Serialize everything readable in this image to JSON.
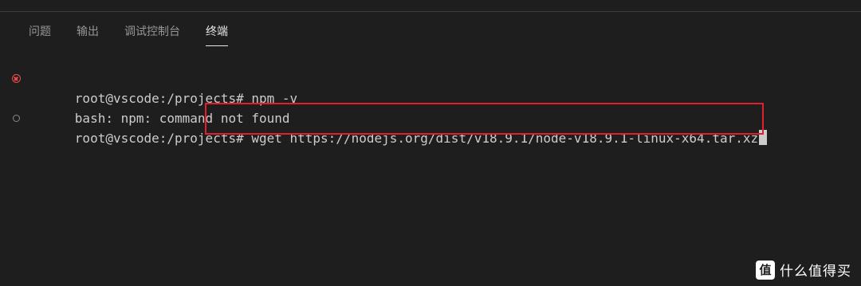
{
  "panel_tabs": [
    {
      "label": "问题",
      "active": false
    },
    {
      "label": "输出",
      "active": false
    },
    {
      "label": "调试控制台",
      "active": false
    },
    {
      "label": "终端",
      "active": true
    }
  ],
  "terminal": {
    "lines": [
      {
        "decoration": "error-icon",
        "text": "root@vscode:/projects# npm -v"
      },
      {
        "decoration": "none",
        "text": "bash: npm: command not found"
      },
      {
        "decoration": "default-icon",
        "text": "root@vscode:/projects# wget https://nodejs.org/dist/v18.9.1/node-v18.9.1-linux-x64.tar.xz"
      }
    ]
  },
  "colors": {
    "background": "#1e1e1e",
    "text": "#cccccc",
    "error": "#f14c4c",
    "highlight_box": "#e0202e"
  },
  "watermark": {
    "logo_char": "值",
    "text": "什么值得买"
  }
}
